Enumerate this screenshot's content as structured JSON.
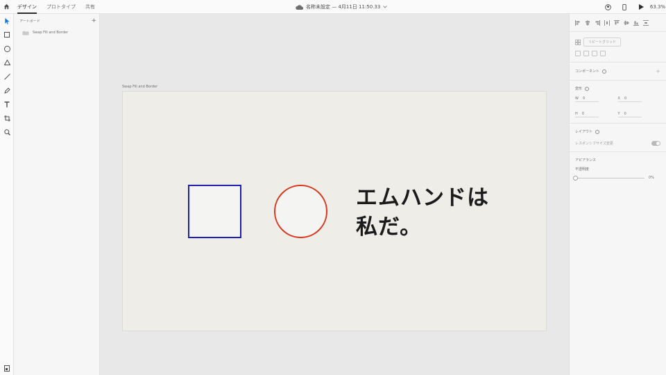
{
  "topbar": {
    "tabs": [
      {
        "label": "デザイン"
      },
      {
        "label": "プロトタイプ"
      },
      {
        "label": "共有"
      }
    ],
    "document_title": "名称未設定 — 4月11日 11:50.33",
    "zoom": "63.3%"
  },
  "tools": [
    "select-tool",
    "rectangle-tool",
    "ellipse-tool",
    "polygon-tool",
    "line-tool",
    "pen-tool",
    "text-tool",
    "artboard-tool",
    "zoom-tool"
  ],
  "layers": {
    "header": "アートボード",
    "item": "Swap Fill and Border"
  },
  "canvas": {
    "artboard_label": "Swap Fill and Border",
    "text_line1": "エムハンドは",
    "text_line2": "私だ。"
  },
  "inspector": {
    "repeat_grid": "リピートグリッド",
    "component_label": "コンポーネント",
    "transform_label": "変形",
    "w_label": "W",
    "w_value": "0",
    "x_label": "X",
    "x_value": "0",
    "h_label": "H",
    "h_value": "0",
    "y_label": "Y",
    "y_value": "0",
    "layout_label": "レイアウト",
    "responsive_label": "レスポンシブサイズ変更",
    "appearance_label": "アピアランス",
    "opacity_label": "不透明度",
    "opacity_value": "0%"
  },
  "colors": {
    "square_border": "#1d1db8",
    "circle_border": "#d8391e",
    "artboard_fill": "#eeede8"
  }
}
